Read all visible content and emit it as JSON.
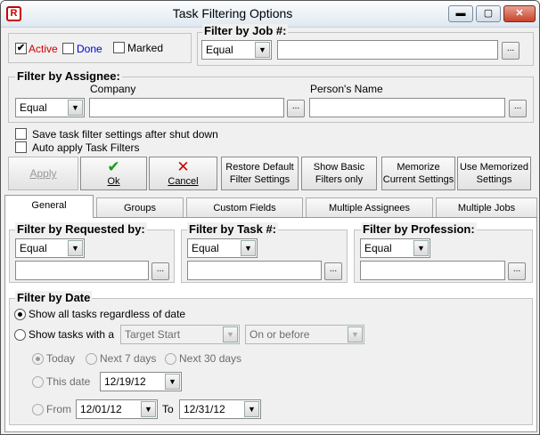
{
  "window": {
    "title": "Task Filtering Options",
    "minimize": "▬",
    "maximize": "▢",
    "close": "✕",
    "icon": "R"
  },
  "status": {
    "active": "Active",
    "done": "Done",
    "marked": "Marked"
  },
  "job": {
    "title": "Filter by Job #:",
    "operator": "Equal",
    "value": ""
  },
  "assignee": {
    "title": "Filter by Assignee:",
    "operator": "Equal",
    "company_label": "Company",
    "company": "",
    "person_label": "Person's Name",
    "person": ""
  },
  "options": {
    "save": "Save task filter settings after shut down",
    "auto": "Auto apply Task Filters"
  },
  "buttons": {
    "apply": "Apply",
    "ok": "Ok",
    "cancel": "Cancel",
    "restore_1": "Restore Default",
    "restore_2": "Filter Settings",
    "basic_1": "Show Basic",
    "basic_2": "Filters only",
    "memorize_1": "Memorize",
    "memorize_2": "Current Settings",
    "usemem_1": "Use Memorized",
    "usemem_2": "Settings"
  },
  "tabs": [
    "General",
    "Groups",
    "Custom Fields",
    "Multiple Assignees",
    "Multiple Jobs"
  ],
  "requested": {
    "title": "Filter by Requested by:",
    "operator": "Equal"
  },
  "tasknum": {
    "title": "Filter by Task #:",
    "operator": "Equal"
  },
  "profession": {
    "title": "Filter by Profession:",
    "operator": "Equal"
  },
  "date": {
    "title": "Filter by Date",
    "show_all": "Show all tasks regardless of date",
    "show_with": "Show tasks with a",
    "field": "Target Start",
    "relation": "On or before",
    "today": "Today",
    "next7": "Next 7 days",
    "next30": "Next 30 days",
    "this_date": "This date",
    "this_date_value": "12/19/12",
    "from": "From",
    "from_value": "12/01/12",
    "to": "To",
    "to_value": "12/31/12"
  },
  "glyphs": {
    "dots": "...",
    "arrow": "▼",
    "check": "✔",
    "cross": "✕"
  },
  "colors": {
    "active": "#cc0000",
    "done": "#0000cc",
    "ok": "#1a9a1a",
    "cancel": "#cc0000"
  }
}
